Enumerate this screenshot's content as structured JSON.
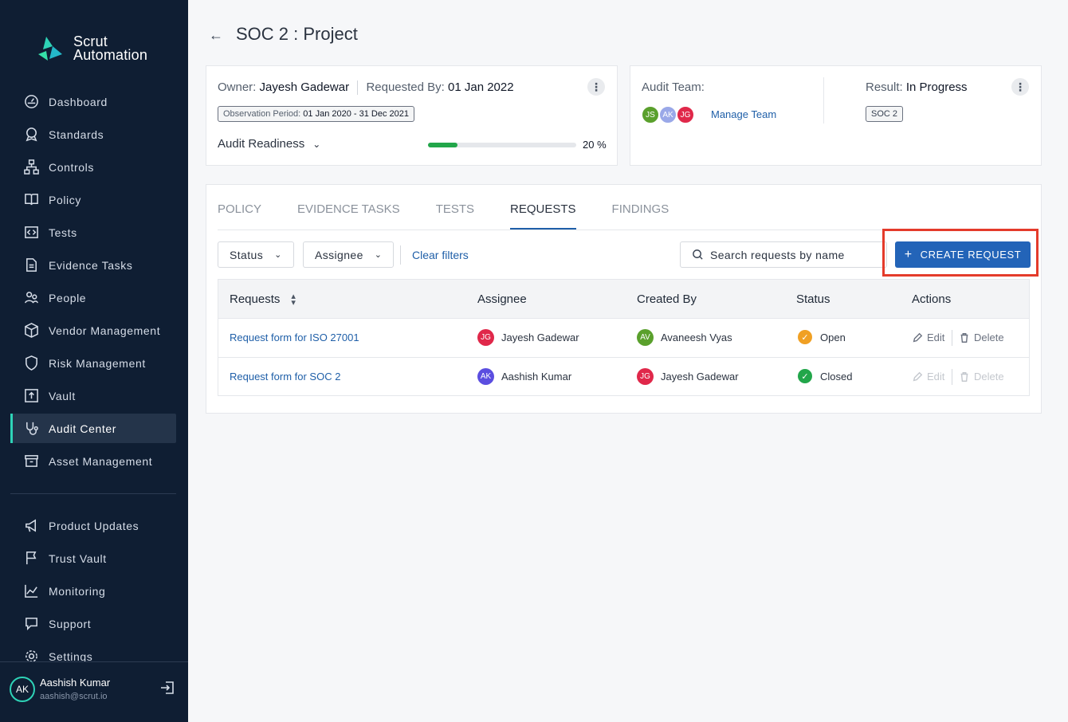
{
  "app": {
    "brand_line1": "Scrut",
    "brand_line2": "Automation"
  },
  "sidebar": {
    "items": [
      {
        "label": "Dashboard",
        "icon": "dashboard-icon"
      },
      {
        "label": "Standards",
        "icon": "award-icon"
      },
      {
        "label": "Controls",
        "icon": "hierarchy-icon"
      },
      {
        "label": "Policy",
        "icon": "book-icon"
      },
      {
        "label": "Tests",
        "icon": "code-icon"
      },
      {
        "label": "Evidence Tasks",
        "icon": "document-icon"
      },
      {
        "label": "People",
        "icon": "people-icon"
      },
      {
        "label": "Vendor Management",
        "icon": "package-icon"
      },
      {
        "label": "Risk Management",
        "icon": "shield-icon"
      },
      {
        "label": "Vault",
        "icon": "upload-icon"
      },
      {
        "label": "Audit Center",
        "icon": "stethoscope-icon",
        "active": true
      },
      {
        "label": "Asset Management",
        "icon": "archive-icon"
      }
    ],
    "secondary": [
      {
        "label": "Product Updates",
        "icon": "megaphone-icon"
      },
      {
        "label": "Trust Vault",
        "icon": "flag-icon"
      },
      {
        "label": "Monitoring",
        "icon": "chart-icon"
      },
      {
        "label": "Support",
        "icon": "chat-icon"
      },
      {
        "label": "Settings",
        "icon": "gear-icon"
      }
    ],
    "user": {
      "initials": "AK",
      "name": "Aashish Kumar",
      "email": "aashish@scrut.io"
    }
  },
  "header": {
    "back_icon": "←",
    "title": "SOC 2 : Project"
  },
  "summary": {
    "owner_label": "Owner:",
    "owner": "Jayesh Gadewar",
    "requested_label": "Requested By:",
    "requested_date": "01 Jan 2022",
    "observation_label": "Observation Period:",
    "observation_value": "01 Jan 2020 - 31 Dec 2021",
    "readiness_label": "Audit Readiness",
    "readiness_percent_text": "20 %",
    "readiness_fraction": 0.2,
    "audit_team_label": "Audit Team:",
    "team": [
      {
        "initials": "JS",
        "color": "#5aa02c"
      },
      {
        "initials": "AK",
        "color": "#9aa8e8"
      },
      {
        "initials": "JG",
        "color": "#e0284a"
      }
    ],
    "manage_team": "Manage Team",
    "result_label": "Result:",
    "result_value": "In Progress",
    "standard_tag": "SOC 2"
  },
  "tabs": [
    "POLICY",
    "EVIDENCE TASKS",
    "TESTS",
    "REQUESTS",
    "FINDINGS"
  ],
  "active_tab": "REQUESTS",
  "filters": {
    "status": "Status",
    "assignee": "Assignee",
    "clear": "Clear filters",
    "search_placeholder": "Search requests by name",
    "create": "CREATE REQUEST"
  },
  "table": {
    "headers": [
      "Requests",
      "Assignee",
      "Created By",
      "Status",
      "Actions"
    ],
    "rows": [
      {
        "request": "Request form for ISO 27001",
        "assignee": {
          "initials": "JG",
          "name": "Jayesh Gadewar",
          "color": "#e0284a"
        },
        "created_by": {
          "initials": "AV",
          "name": "Avaneesh Vyas",
          "color": "#5aa02c"
        },
        "status": "Open",
        "status_color": "#f0a024",
        "edit": "Edit",
        "delete": "Delete"
      },
      {
        "request": "Request form for SOC 2",
        "assignee": {
          "initials": "AK",
          "name": "Aashish Kumar",
          "color": "#5b4ee0"
        },
        "created_by": {
          "initials": "JG",
          "name": "Jayesh Gadewar",
          "color": "#e0284a"
        },
        "status": "Closed",
        "status_color": "#22a64a",
        "edit": "Edit",
        "delete": "Delete"
      }
    ]
  }
}
